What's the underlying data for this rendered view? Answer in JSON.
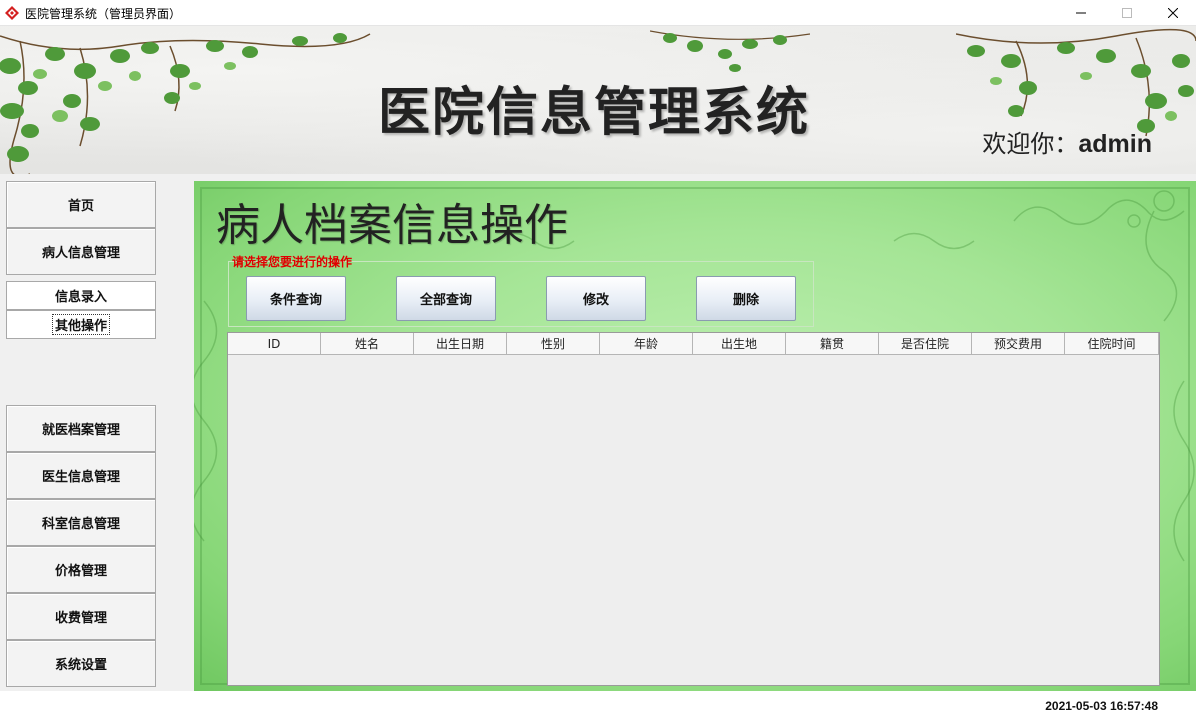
{
  "window": {
    "title": "医院管理系统（管理员界面）",
    "icon": "app-diamond-icon"
  },
  "banner": {
    "title": "医院信息管理系统",
    "welcome_prefix": "欢迎你：",
    "username": "admin"
  },
  "sidebar": {
    "items": [
      {
        "label": "首页"
      },
      {
        "label": "病人信息管理"
      }
    ],
    "subitems": [
      {
        "label": "信息录入"
      },
      {
        "label": "其他操作"
      }
    ],
    "items_bottom": [
      {
        "label": "就医档案管理"
      },
      {
        "label": "医生信息管理"
      },
      {
        "label": "科室信息管理"
      },
      {
        "label": "价格管理"
      },
      {
        "label": "收费管理"
      },
      {
        "label": "系统设置"
      }
    ]
  },
  "main": {
    "title": "病人档案信息操作",
    "group_legend": "请选择您要进行的操作",
    "buttons": [
      "条件查询",
      "全部查询",
      "修改",
      "删除"
    ],
    "table": {
      "columns": [
        "ID",
        "姓名",
        "出生日期",
        "性别",
        "年龄",
        "出生地",
        "籍贯",
        "是否住院",
        "预交费用",
        "住院时间"
      ],
      "rows": []
    }
  },
  "status": {
    "datetime": "2021-05-03 16:57:48"
  },
  "colors": {
    "legend_red": "#e00000",
    "main_green": "#a5e596"
  }
}
